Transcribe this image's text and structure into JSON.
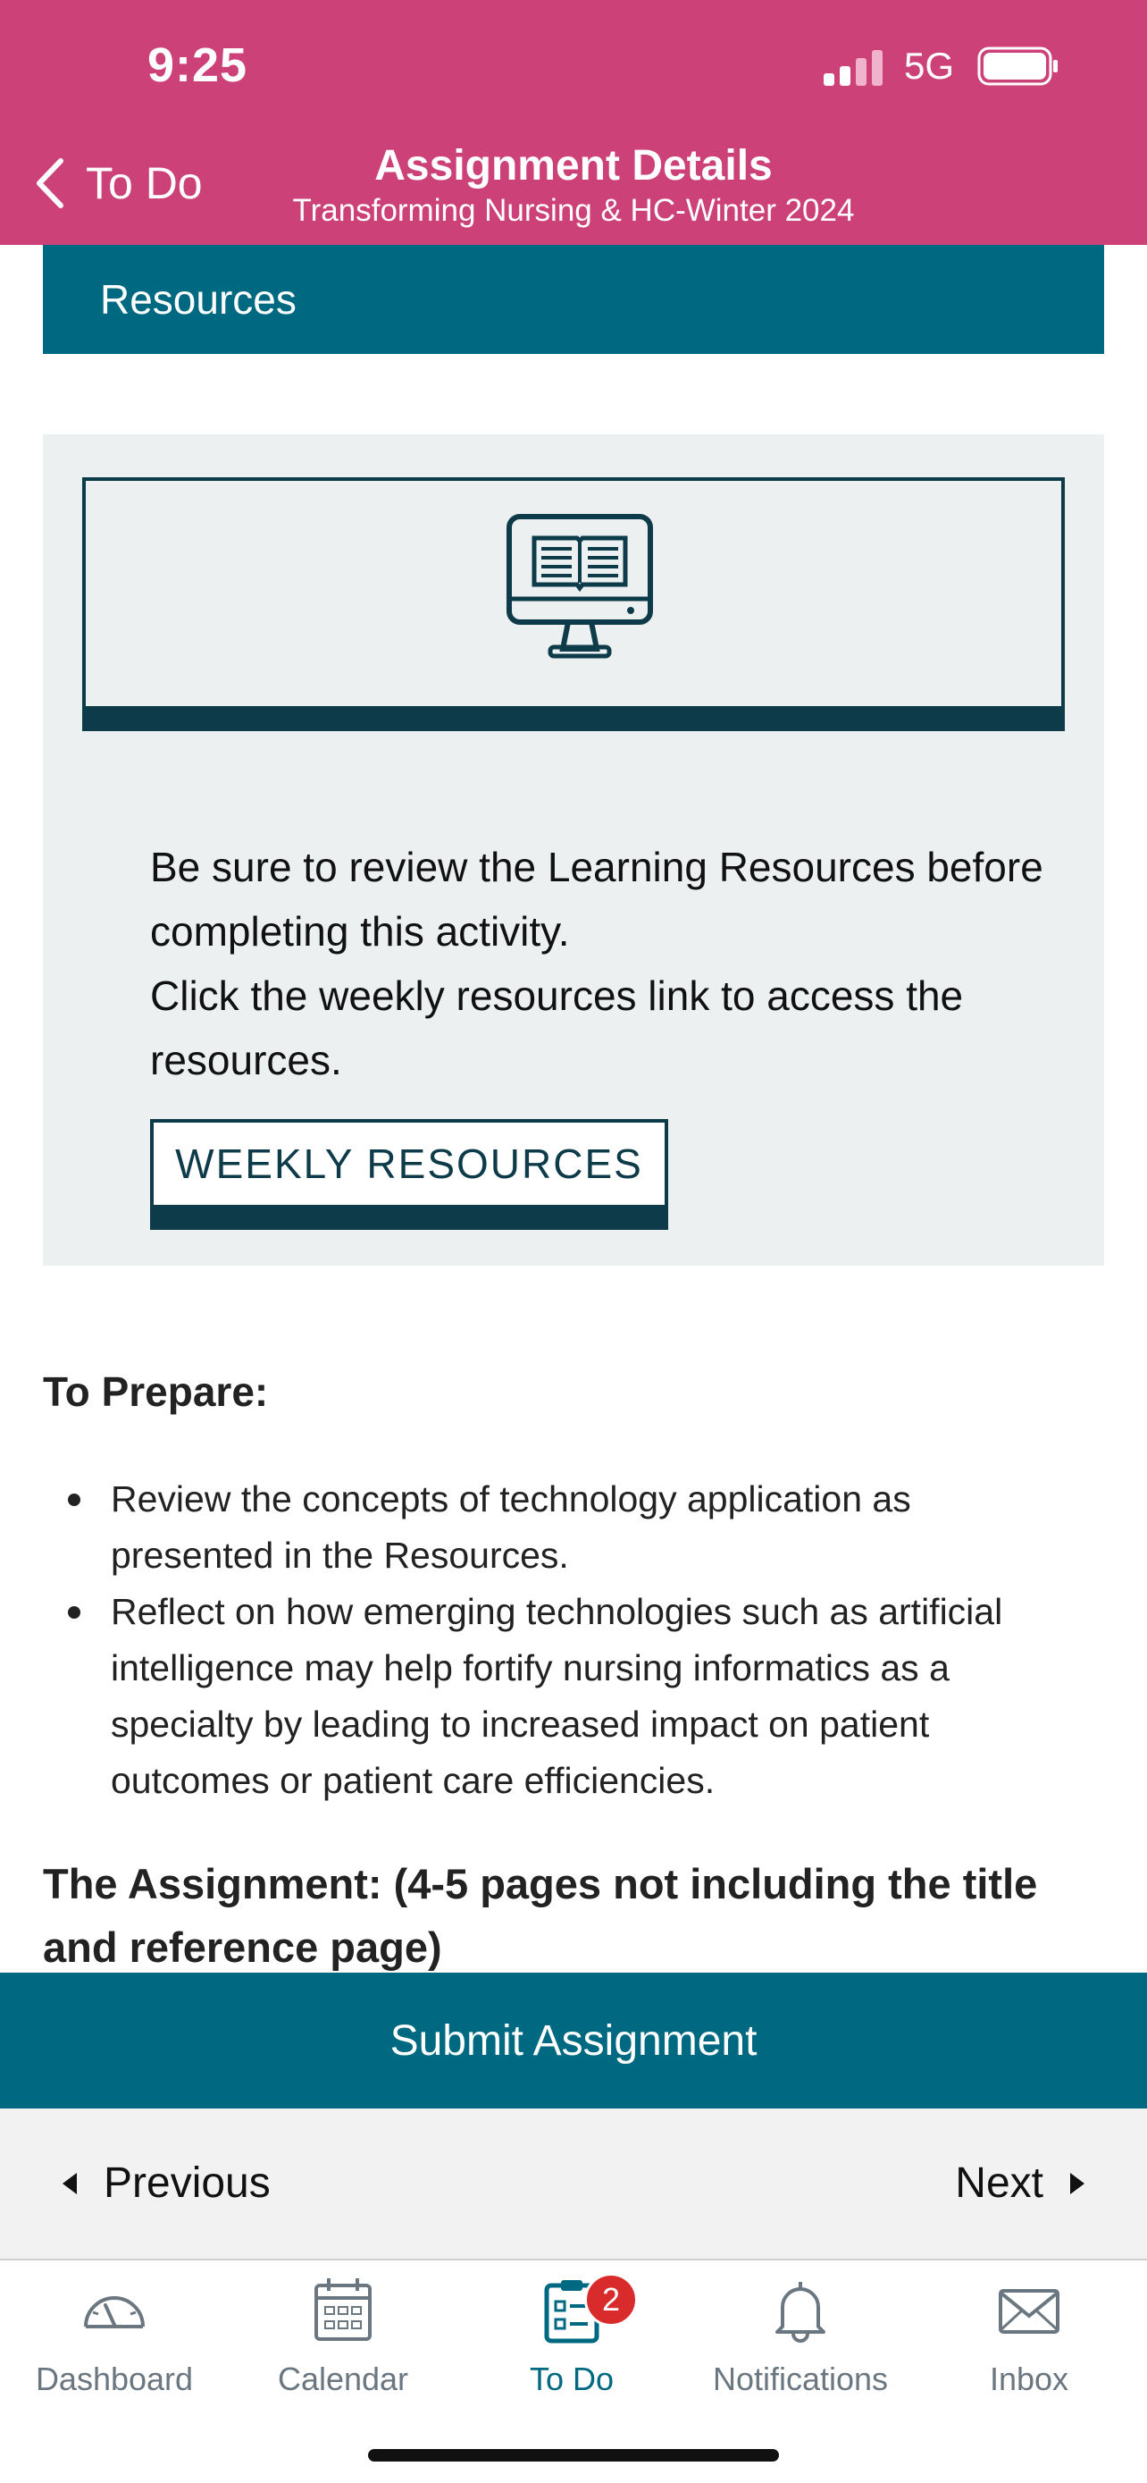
{
  "status_bar": {
    "time": "9:25",
    "network": "5G"
  },
  "header": {
    "back_label": "To Do",
    "title": "Assignment Details",
    "subtitle": "Transforming Nursing & HC-Winter 2024"
  },
  "colors": {
    "header": "#cc4178",
    "teal": "#006982",
    "dark_teal": "#0d3b4a",
    "card": "#ecf0f1"
  },
  "resources_bar": {
    "label": "Resources"
  },
  "resource_card": {
    "icon": "computer-book-icon",
    "text_line1": "Be sure to review the Learning Resources before completing this activity.",
    "text_line2": "Click the weekly resources link to access the resources.",
    "button_label": "WEEKLY RESOURCES"
  },
  "prepare": {
    "title": "To Prepare:",
    "items": [
      "Review the concepts of technology application as presented in the Resources.",
      "Reflect on how emerging technologies such as artificial intelligence may help fortify nursing informatics as a specialty by leading to increased impact on patient outcomes or patient care efficiencies."
    ]
  },
  "assignment": {
    "title": "The Assignment: (4-5 pages not including the title and reference page)"
  },
  "submit_label": "Submit Assignment",
  "pager": {
    "previous": "Previous",
    "next": "Next"
  },
  "tabs": [
    {
      "label": "Dashboard",
      "icon": "dashboard-icon"
    },
    {
      "label": "Calendar",
      "icon": "calendar-icon"
    },
    {
      "label": "To Do",
      "icon": "todo-icon",
      "badge": "2",
      "active": true
    },
    {
      "label": "Notifications",
      "icon": "bell-icon"
    },
    {
      "label": "Inbox",
      "icon": "mail-icon"
    }
  ]
}
